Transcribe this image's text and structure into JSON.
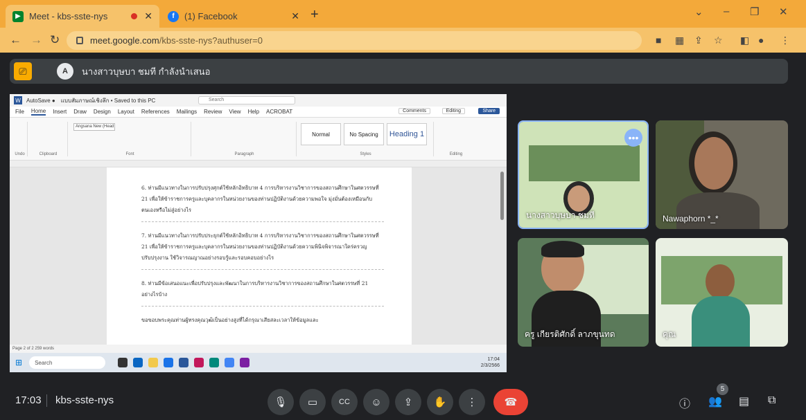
{
  "browser": {
    "tabs": [
      {
        "title": "Meet - kbs-sste-nys",
        "recording": true
      },
      {
        "title": "(1) Facebook"
      }
    ],
    "url_host": "meet.google.com",
    "url_path": "/kbs-sste-nys?authuser=0",
    "new_tab": "+"
  },
  "meet": {
    "presenting_text": "นางสาวบุษบา ชมที กำลังนำเสนอ",
    "presenter_initial": "A",
    "time": "17:03",
    "meeting_code": "kbs-sste-nys",
    "participant_count": "5",
    "tiles": [
      {
        "name": "นางสาวบุษบา ชมที"
      },
      {
        "name": "Nawaphorn *_*"
      },
      {
        "name": "ครู เกียรติศักดิ์ ลาภขุนทด"
      },
      {
        "name": "คุณ"
      }
    ]
  },
  "shared_screen": {
    "word_title": "แบบสัมภาษณ์เชิงลึก • Saved to this PC",
    "search_placeholder": "Search",
    "menu": [
      "File",
      "Home",
      "Insert",
      "Draw",
      "Design",
      "Layout",
      "References",
      "Mailings",
      "Review",
      "View",
      "Help",
      "ACROBAT"
    ],
    "comments": "Comments",
    "editing": "Editing",
    "share": "Share",
    "font_name": "Angsana New (Head",
    "styles": [
      "Normal",
      "No Spacing",
      "Heading 1"
    ],
    "group_labels": [
      "Undo",
      "Clipboard",
      "Font",
      "Paragraph",
      "Styles",
      "Editing"
    ],
    "paragraphs": [
      "6. ท่านมีแนวทางในการปรับปรุงศุกต์ใช้หลักอิทธิบาท 4 การบริหารงานวิชาการของสถานศึกษาในศตวรรษที่ 21 เพื่อให้ข้าราชการครูและบุคลากรในหน่วยงานของท่านปฏิบัติงานด้วยความพอใจ มุ่งมั่นต้องเหมือนกับตนเองหรือไม่สู่อย่างไร",
      "7. ท่านมีแนวทางในการปรับประยุกต์ใช้หลักอิทธิบาท 4 การบริหารงานวิชาการของสถานศึกษาในศตวรรษที่ 21 เพื่อให้ข้าราชการครูและบุคลากรในหน่วยงานของท่านปฏิบัติงานด้วยความพินิจพิจารณาใคร่ครวญปรับปรุงงาน ใช้วิจารณญาณอย่างรอบรู้และรอบคอบอย่างไร",
      "8. ท่านมีข้อเสนอแนะเพื่อปรับปรุงและพัฒนาในการบริหารงานวิชาการของสถานศึกษาในศตวรรษที่ 21 อย่างไรบ้าง",
      "ขอขอบพระคุณท่านผู้ทรงคุณวุฒิเป็นอย่างสูงที่ได้กรุณาเสียสละเวลาให้ข้อมูลและ"
    ],
    "status_left": "Page 2 of 2   259 words",
    "taskbar_search": "Search",
    "tray_time": "17:04",
    "tray_date": "2/3/2566"
  },
  "colors": {
    "chrome_tab_bar": "#f3a93a",
    "meet_bg": "#202124",
    "end_call": "#ea4335"
  }
}
